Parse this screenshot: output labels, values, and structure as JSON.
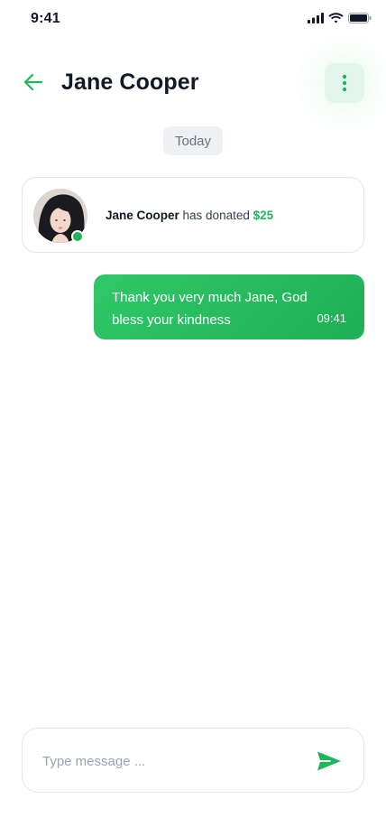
{
  "status_bar": {
    "time": "9:41",
    "icons": [
      "cellular-signal-icon",
      "wifi-icon",
      "battery-icon"
    ]
  },
  "header": {
    "back_icon": "arrow-left-icon",
    "title": "Jane Cooper",
    "menu_icon": "more-vertical-icon"
  },
  "conversation": {
    "date_label": "Today",
    "donation": {
      "donor_name": "Jane Cooper",
      "action_text": " has donated ",
      "amount": "$25",
      "online": true
    },
    "messages": [
      {
        "text": "Thank you very much Jane, God bless your kindness",
        "time": "09:41",
        "outgoing": true
      }
    ]
  },
  "composer": {
    "placeholder": "Type message ...",
    "value": "",
    "send_icon": "send-icon"
  },
  "colors": {
    "accent": "#22b45a",
    "accent_light": "#e4f6ec",
    "chip_bg": "#eef0f3",
    "text_dark": "#111827",
    "text_muted": "#9ca3af"
  }
}
